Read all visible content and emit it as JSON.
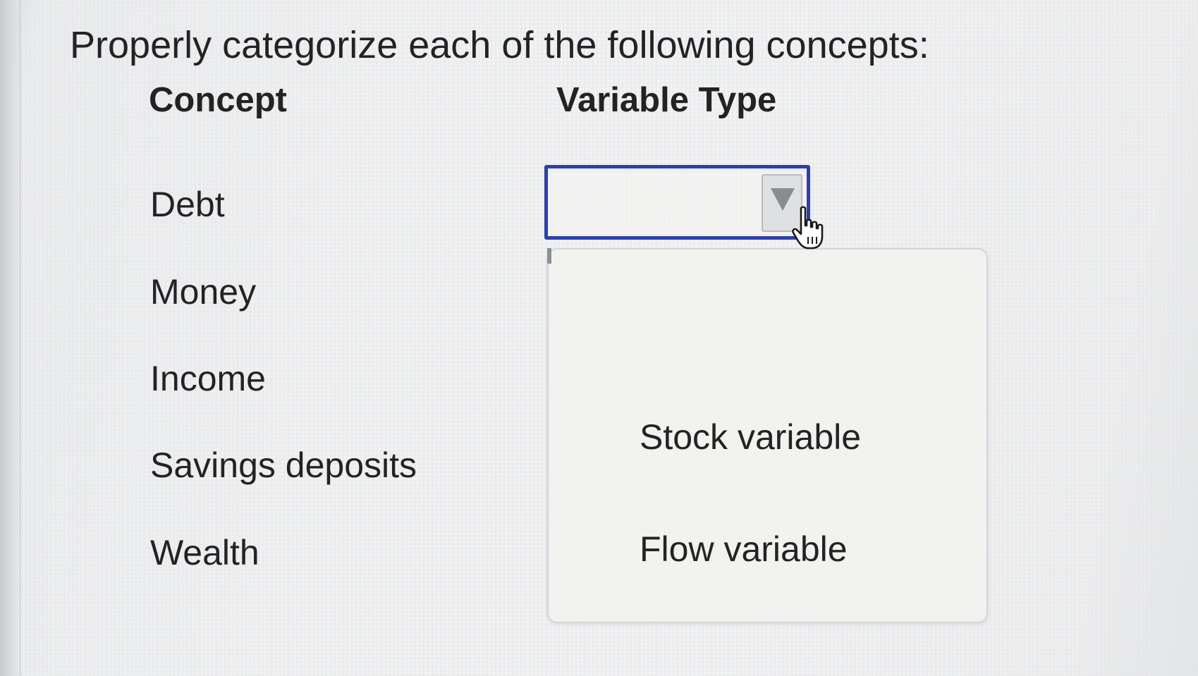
{
  "question": {
    "text": "Properly categorize each of the following concepts:"
  },
  "table": {
    "headers": {
      "concept": "Concept",
      "variable_type": "Variable Type"
    },
    "concepts": [
      "Debt",
      "Money",
      "Income",
      "Savings deposits",
      "Wealth"
    ]
  },
  "select": {
    "selected_value": "",
    "arrow_icon": "triangle-down-icon",
    "options": [
      "",
      "Stock variable",
      "Flow variable"
    ]
  },
  "cursor": {
    "icon": "hand-pointer-icon"
  },
  "colors": {
    "focus_border": "#2c3fb8",
    "text": "#232323",
    "arrow": "#8a8c90"
  }
}
